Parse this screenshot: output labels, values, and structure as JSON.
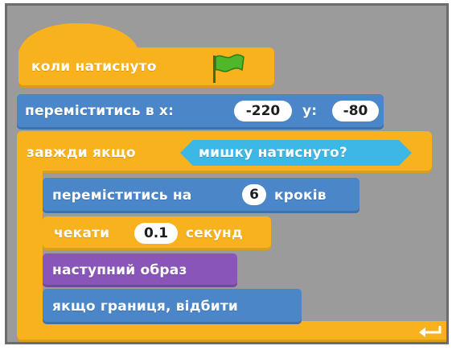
{
  "blocks": {
    "when_flag_clicked": "коли натиснуто",
    "go_to_xy": {
      "label": "переміститись в x:",
      "x": "-220",
      "y_label": "y:",
      "y": "-80"
    },
    "forever_if": {
      "label": "завжди якщо",
      "condition": "мишку натиснуто?"
    },
    "move_steps": {
      "label": "переміститись на",
      "steps": "6",
      "suffix": "кроків"
    },
    "wait": {
      "label": "чекати",
      "seconds": "0.1",
      "suffix": "секунд"
    },
    "next_costume": "наступний образ",
    "bounce": "якщо границя, відбити"
  },
  "icons": {
    "flag": "green-flag-icon",
    "loop_arrow": "loop-arrow-icon"
  },
  "colors": {
    "events_control": "#f7b21d",
    "motion": "#4a86c8",
    "sensing": "#3cb7e6",
    "looks": "#8a55b8",
    "background": "#9b9b9b"
  }
}
